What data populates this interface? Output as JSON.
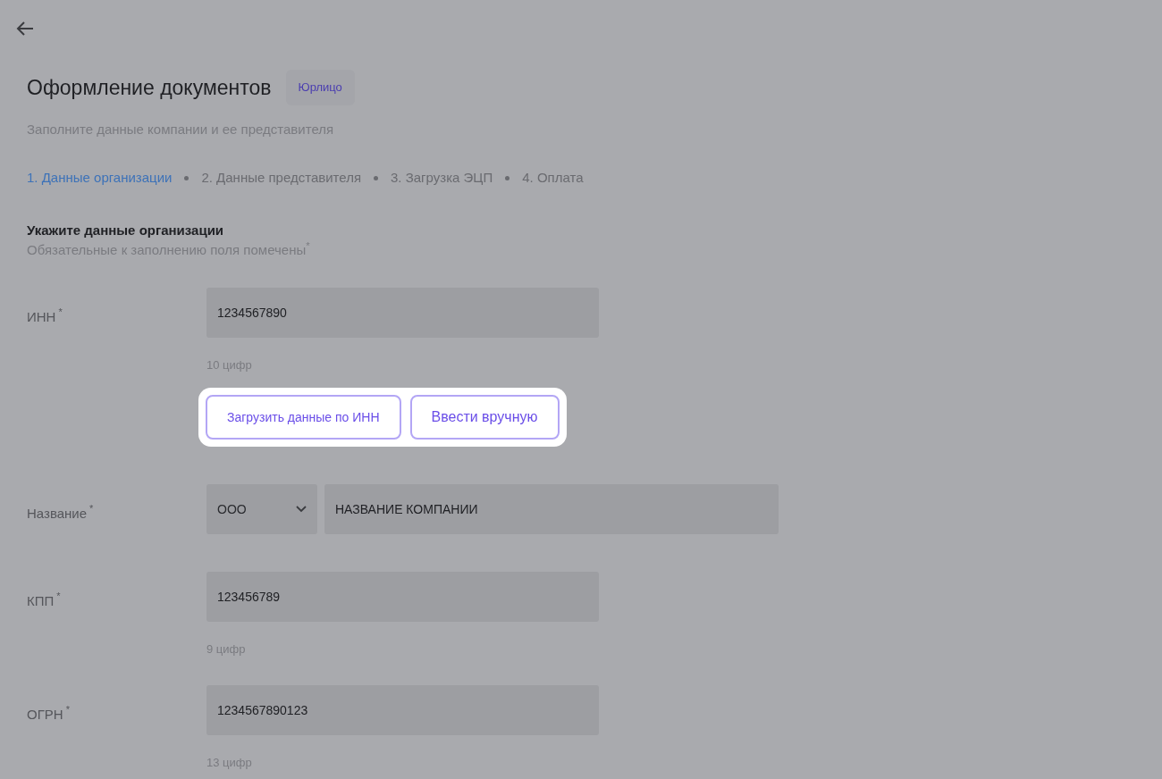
{
  "header": {
    "title": "Оформление документов",
    "badge": "Юрлицо",
    "subtitle": "Заполните данные компании и ее представителя"
  },
  "steps": [
    {
      "label": "1. Данные организации",
      "selected": true
    },
    {
      "label": "2. Данные представителя",
      "selected": false
    },
    {
      "label": "3. Загрузка ЭЦП",
      "selected": false
    },
    {
      "label": "4. Оплата",
      "selected": false
    }
  ],
  "section": {
    "title": "Укажите данные организации",
    "note": "Обязательные к заполнению поля помечены",
    "note_mark": "*"
  },
  "fields": [
    {
      "kind": "text",
      "label": "ИНН",
      "mark": "*",
      "value": "1234567890",
      "hint": "10 цифр",
      "actions": [
        "Загрузить данные по ИНН",
        "Ввести вручную"
      ]
    },
    {
      "kind": "company",
      "label": "Название",
      "mark": "*",
      "form": "ООО",
      "value": "НАЗВАНИЕ КОМПАНИИ"
    },
    {
      "kind": "text",
      "label": "КПП",
      "mark": "*",
      "value": "123456789",
      "hint": "9 цифр"
    },
    {
      "kind": "text",
      "label": "ОГРН",
      "mark": "*",
      "value": "1234567890123",
      "hint": "13 цифр"
    }
  ]
}
